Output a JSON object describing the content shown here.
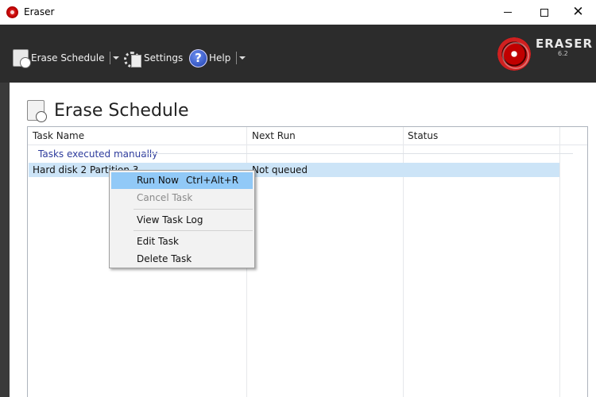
{
  "window": {
    "title": "Eraser",
    "controls": {
      "minimize": "",
      "maximize": "",
      "close": "✕"
    }
  },
  "toolbar": {
    "erase_schedule_label": "Erase Schedule",
    "settings_label": "Settings",
    "help_label": "Help",
    "help_icon_glyph": "?"
  },
  "logo": {
    "text": "ERASER",
    "version": "6.2"
  },
  "page": {
    "title": "Erase Schedule"
  },
  "list": {
    "columns": [
      "Task Name",
      "Next Run",
      "Status"
    ],
    "group_header": "Tasks executed manually",
    "rows": [
      {
        "task_name": "Hard disk 2 Partition 3",
        "next_run": "Not queued",
        "status": ""
      }
    ]
  },
  "context_menu": {
    "items": [
      {
        "label": "Run Now",
        "shortcut": "Ctrl+Alt+R",
        "state": "highlighted"
      },
      {
        "label": "Cancel Task",
        "shortcut": "",
        "state": "disabled"
      },
      {
        "label": "View Task Log",
        "shortcut": "",
        "state": "enabled"
      },
      {
        "label": "Edit Task",
        "shortcut": "",
        "state": "enabled"
      },
      {
        "label": "Delete Task",
        "shortcut": "",
        "state": "enabled"
      }
    ]
  },
  "colors": {
    "toolbar_bg": "#2c2c2c",
    "selection_bg": "#cce4f7",
    "menu_highlight": "#91c9f7",
    "group_header_text": "#2d3b9c"
  }
}
